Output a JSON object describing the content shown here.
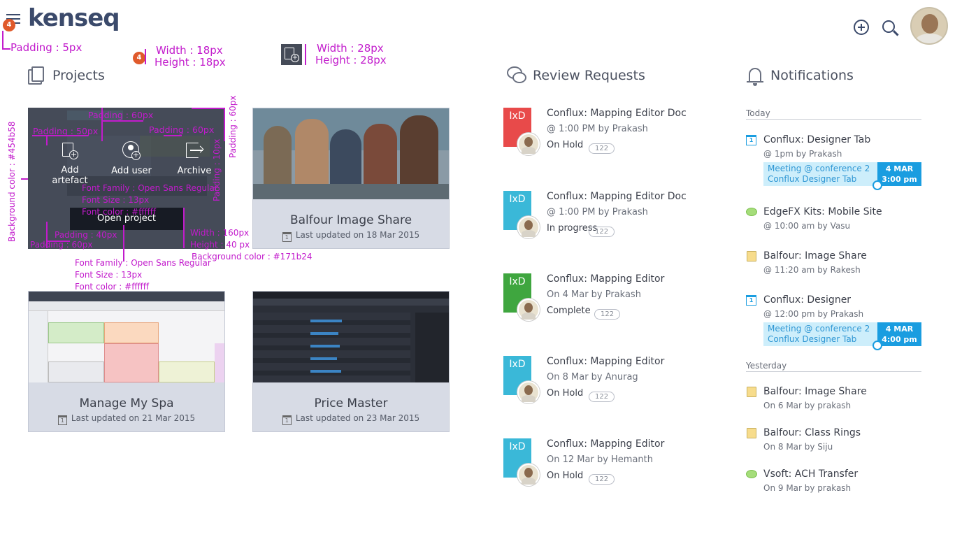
{
  "header": {
    "brand": "kenseq",
    "badge_count": "4"
  },
  "annotations": {
    "padding_5": "Padding : 5px",
    "badge_width": "Width : 18px",
    "badge_height": "Height : 18px",
    "icon_width": "Width : 28px",
    "icon_height": "Height : 28px",
    "pad60_top": "Padding : 60px",
    "pad50": "Padding : 50px",
    "pad60_mid": "Padding : 60px",
    "pad60_right": "Padding : 60px",
    "pad10": "Padding : 10px",
    "font_family_1": "Font Family : Open Sans Regular",
    "font_size_1": "Font Size : 13px",
    "font_color_1": "Font color : #ffffff",
    "pad40": "Padding : 40px",
    "pad60_bottom": "Padding : 60px",
    "btn_width": "Width : 160px",
    "btn_height": "Height : 40 px",
    "bg_color_btn": "Background color : #171b24",
    "bg_color_card": "Background color : #454b58",
    "font_family_2": "Font Family : Open Sans Regular",
    "font_size_2": "Font Size : 13px",
    "font_color_2": "Font color : #ffffff"
  },
  "projects": {
    "title": "Projects",
    "actions": {
      "add_artefact": "Add artefact",
      "add_user": "Add user",
      "archive": "Archive",
      "open_project": "Open project"
    },
    "cards": [
      {
        "title": "Balfour Image Share",
        "updated": "Last updated on 18 Mar 2015"
      },
      {
        "title": "Manage My Spa",
        "updated": "Last updated on 21 Mar 2015"
      },
      {
        "title": "Price Master",
        "updated": "Last updated on 23 Mar 2015"
      }
    ]
  },
  "review_requests": {
    "title": "Review Requests",
    "items": [
      {
        "tag": "IxD",
        "color": "#e84a4a",
        "title": "Conflux: Mapping Editor Doc",
        "sub": "@ 1:00 PM by Prakash",
        "status": "On Hold",
        "count": "122"
      },
      {
        "tag": "IxD",
        "color": "#3ab8d8",
        "title": "Conflux: Mapping Editor Doc",
        "sub": "@ 1:00 PM by Prakash",
        "status": "In progress",
        "count": "122"
      },
      {
        "tag": "IxD",
        "color": "#3fa63f",
        "title": "Conflux: Mapping Editor",
        "sub": "On 4 Mar by Prakash",
        "status": "Complete",
        "count": "122"
      },
      {
        "tag": "IxD",
        "color": "#3ab8d8",
        "title": "Conflux: Mapping Editor",
        "sub": "On 8 Mar by Anurag",
        "status": "On Hold",
        "count": "122"
      },
      {
        "tag": "IxD",
        "color": "#3ab8d8",
        "title": "Conflux: Mapping Editor",
        "sub": "On 12 Mar by Hemanth",
        "status": "On Hold",
        "count": "122"
      }
    ]
  },
  "notifications": {
    "title": "Notifications",
    "today": "Today",
    "yesterday": "Yesterday",
    "items": [
      {
        "icon": "calendar-icon",
        "title": "Conflux: Designer Tab",
        "sub": "@ 1pm by Prakash",
        "event_line1": "Meeting @ conference 2",
        "event_line2": "Conflux Designer Tab",
        "event_date": "4 MAR",
        "event_time": "3:00 pm"
      },
      {
        "icon": "chat-icon",
        "title": "EdgeFX Kits: Mobile Site",
        "sub": "@ 10:00 am by Vasu"
      },
      {
        "icon": "note-icon",
        "title": "Balfour: Image Share",
        "sub": "@ 11:20 am by Rakesh"
      },
      {
        "icon": "calendar-icon",
        "title": "Conflux: Designer",
        "sub": "@ 12:00 pm by Prakash",
        "event_line1": "Meeting @ conference 2",
        "event_line2": "Conflux Designer Tab",
        "event_date": "4 MAR",
        "event_time": "4:00 pm"
      },
      {
        "icon": "note-icon",
        "title": "Balfour: Image Share",
        "sub": "On 6 Mar by prakash"
      },
      {
        "icon": "note-icon",
        "title": "Balfour: Class Rings",
        "sub": "On 8 Mar by Siju"
      },
      {
        "icon": "chat-icon",
        "title": "Vsoft: ACH Transfer",
        "sub": "On 9 Mar by prakash"
      }
    ]
  },
  "colors": {
    "overlay_bg": "#454b58",
    "button_bg": "#171b24",
    "accent_blue": "#1a9de0",
    "annotation": "#c21bcc"
  }
}
